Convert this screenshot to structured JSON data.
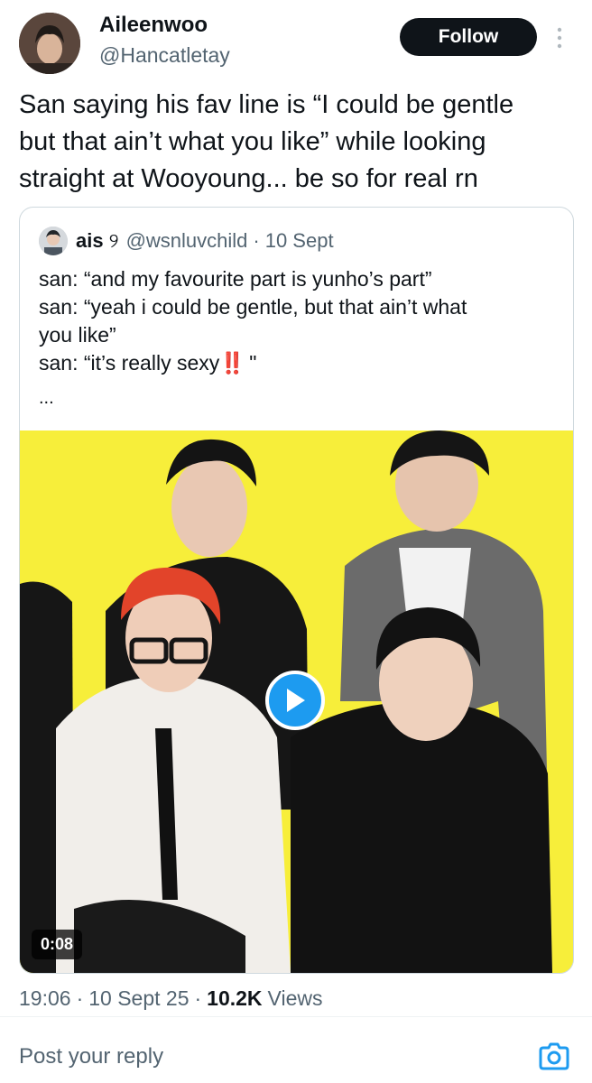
{
  "author": {
    "name": "Aileenwoo",
    "handle": "@Hancatletay",
    "avatar_icon": "profile-photo"
  },
  "actions": {
    "follow_label": "Follow",
    "more_icon": "vertical-ellipsis-icon"
  },
  "tweet": {
    "text": "San saying his fav line is “I could be gentle\nbut that ain’t what you like” while looking\nstraight at Wooyoung... be so for real rn"
  },
  "quote": {
    "name": "ais",
    "name_glyph": "୨",
    "handle": "@wsnluvchild",
    "separator": "·",
    "date": "10 Sept",
    "lines": [
      "san: “and my favourite part is yunho’s part”",
      "san: “yeah i could be gentle, but that ain’t what",
      "you like”"
    ],
    "last_line_prefix": "san: “it’s really sexy",
    "last_line_emoji": "‼️",
    "last_line_suffix": " \"",
    "ellipsis": "...",
    "video": {
      "duration": "0:08",
      "background_color": "#f7ee3a"
    }
  },
  "meta": {
    "time": "19:06",
    "separator": "·",
    "date": "10 Sept 25",
    "views_count": "10.2K",
    "views_label": "Views"
  },
  "reply": {
    "placeholder": "Post your reply",
    "camera_icon": "camera-icon"
  },
  "colors": {
    "accent": "#1d9bf0",
    "text": "#0f1419",
    "secondary": "#536471",
    "border": "#cfd9de"
  }
}
